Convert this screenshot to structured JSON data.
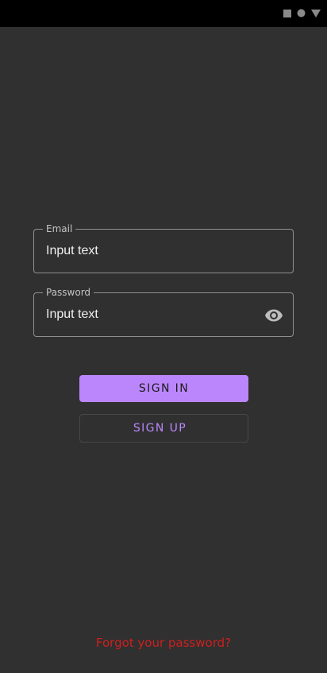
{
  "status_bar": {
    "icons": [
      "square-icon",
      "circle-icon",
      "triangle-down-icon"
    ]
  },
  "form": {
    "email": {
      "label": "Email",
      "value": "Input text"
    },
    "password": {
      "label": "Password",
      "value": "Input text",
      "toggle_icon": "eye-icon"
    }
  },
  "buttons": {
    "sign_in": "SIGN IN",
    "sign_up": "SIGN UP"
  },
  "links": {
    "forgot_password": "Forgot your password?"
  },
  "colors": {
    "background": "#303030",
    "status_bar": "#000000",
    "accent": "#bb86fc",
    "link": "#cf1f1f"
  }
}
